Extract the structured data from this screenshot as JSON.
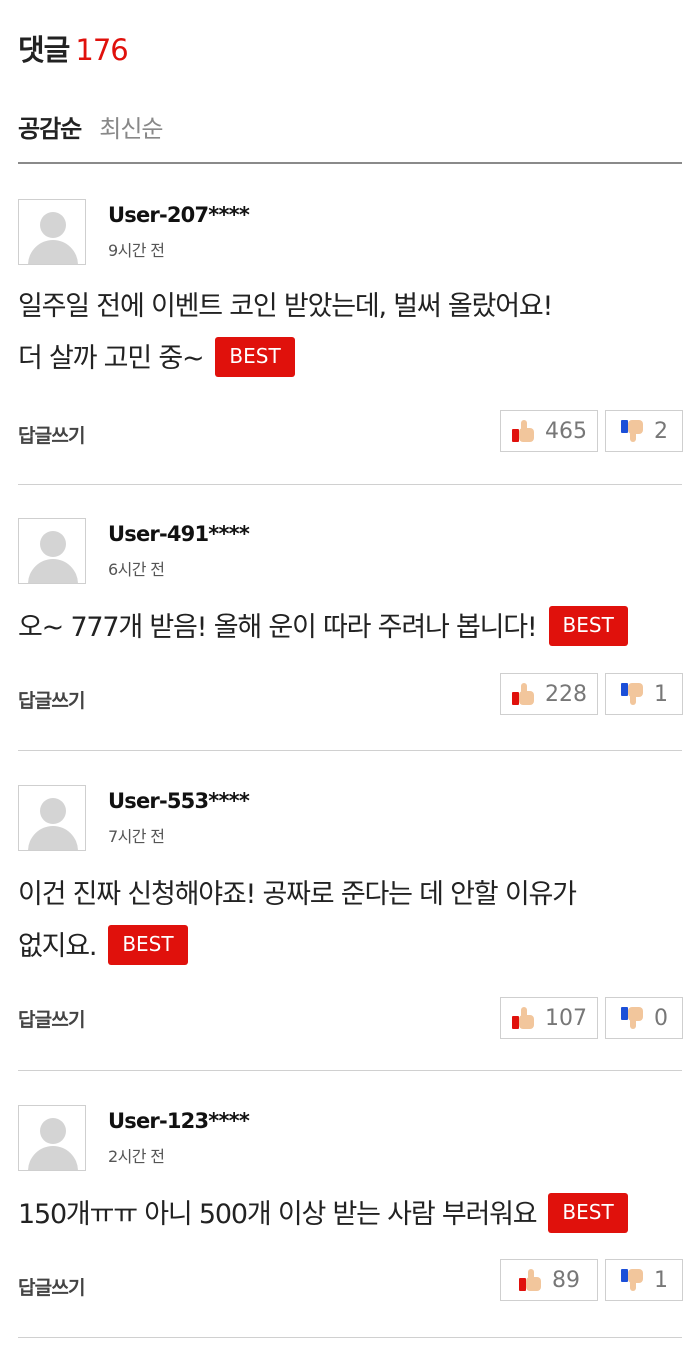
{
  "header": {
    "title": "댓글",
    "count": "176"
  },
  "sort_tabs": [
    {
      "label": "공감순",
      "active": true
    },
    {
      "label": "최신순",
      "active": false
    }
  ],
  "comments": [
    {
      "username": "User-207****",
      "time": "9시간 전",
      "lines": [
        "일주일 전에 이벤트 코인 받았는데, 벌써 올랐어요!",
        "더 살까 고민 중~"
      ],
      "badge": "BEST",
      "reply_label": "답글쓰기",
      "likes": "465",
      "dislikes": "2"
    },
    {
      "username": "User-491****",
      "time": "6시간 전",
      "lines": [
        "오~ 777개 받음! 올해 운이 따라 주려나 봅니다!"
      ],
      "badge": "BEST",
      "reply_label": "답글쓰기",
      "likes": "228",
      "dislikes": "1"
    },
    {
      "username": "User-553****",
      "time": "7시간 전",
      "lines": [
        "이건 진짜 신청해야죠! 공짜로 준다는 데 안할 이유가",
        "없지요."
      ],
      "badge": "BEST",
      "reply_label": "답글쓰기",
      "likes": "107",
      "dislikes": "0"
    },
    {
      "username": "User-123****",
      "time": "2시간 전",
      "lines": [
        "150개ㅠㅠ 아니 500개 이상 받는 사람 부러워요"
      ],
      "badge": "BEST",
      "reply_label": "답글쓰기",
      "likes": "89",
      "dislikes": "1"
    }
  ],
  "colors": {
    "accent": "#e0110c",
    "dislike_cuff": "#1c4fd8",
    "thumb_skin": "#f2c69c",
    "inactive_tab": "#888888"
  },
  "icons": {
    "avatar": "default-user-avatar-icon",
    "like": "thumbs-up-icon",
    "dislike": "thumbs-down-icon"
  }
}
